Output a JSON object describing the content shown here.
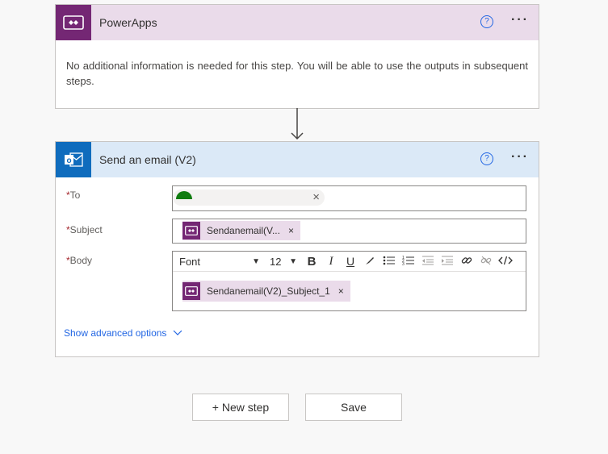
{
  "powerapps_card": {
    "title": "PowerApps",
    "help_glyph": "?",
    "more_glyph": "···",
    "info": "No additional information is needed for this step. You will be able to use the outputs in subsequent steps."
  },
  "email_card": {
    "title": "Send an email (V2)",
    "help_glyph": "?",
    "more_glyph": "···",
    "to": {
      "label": "To",
      "required_mark": "*",
      "remove_glyph": "×"
    },
    "subject": {
      "label": "Subject",
      "required_mark": "*",
      "token_text": "Sendanemail(V...",
      "remove_glyph": "×"
    },
    "body": {
      "label": "Body",
      "required_mark": "*",
      "font_value": "Font",
      "size_value": "12",
      "toolbar": [
        "B",
        "I",
        "U"
      ],
      "token_text": "Sendanemail(V2)_Subject_1",
      "remove_glyph": "×"
    },
    "advanced_link": "Show advanced options"
  },
  "footer": {
    "new_step": "+ New step",
    "save": "Save"
  },
  "colors": {
    "powerapps_purple": "#742774",
    "outlook_blue": "#0f6cbd",
    "link_blue": "#2266e3"
  },
  "icons": [
    "powerapps-icon",
    "outlook-icon",
    "help-icon",
    "more-icon",
    "arrow-down-icon",
    "chevron-down-icon",
    "bold-icon",
    "italic-icon",
    "underline-icon",
    "highlight-icon",
    "bullet-list-icon",
    "numbered-list-icon",
    "outdent-icon",
    "indent-icon",
    "link-icon",
    "unlink-icon",
    "code-view-icon"
  ]
}
